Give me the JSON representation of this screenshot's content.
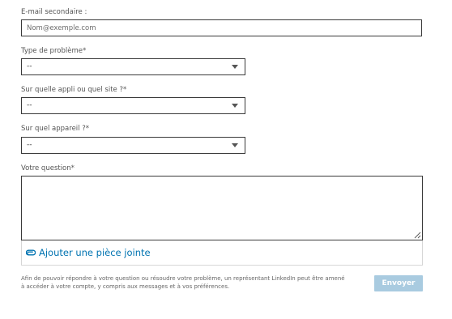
{
  "form": {
    "secondary_email": {
      "label": "E-mail secondaire :",
      "placeholder": "Nom@exemple.com",
      "value": ""
    },
    "problem_type": {
      "label": "Type de problème*",
      "selected": "--"
    },
    "app_or_site": {
      "label": "Sur quelle appli ou quel site ?*",
      "selected": "--"
    },
    "device": {
      "label": "Sur quel appareil ?*",
      "selected": "--"
    },
    "question": {
      "label": "Votre question*",
      "value": ""
    },
    "attachment": {
      "label": "Ajouter une pièce jointe",
      "icon": "paperclip-icon"
    },
    "disclaimer": "Afin de pouvoir répondre à votre question ou résoudre votre problème, un représentant LinkedIn peut être amené à accéder à votre compte, y compris aux messages et à vos préférences.",
    "submit_label": "Envoyer"
  },
  "colors": {
    "link": "#0073b1",
    "submit_disabled_bg": "#a9cbe0",
    "border": "#3a3a3a"
  }
}
